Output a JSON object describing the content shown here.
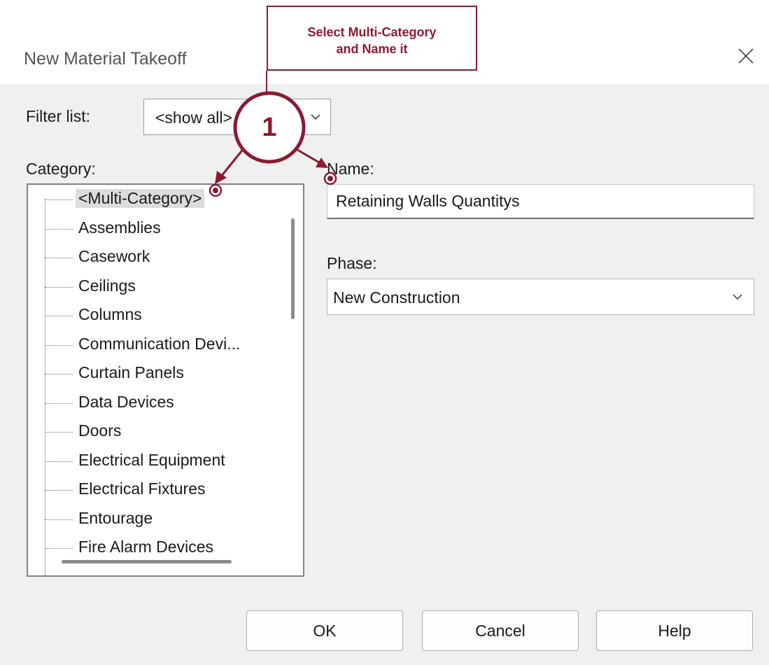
{
  "dialog": {
    "title": "New Material Takeoff",
    "filter_label": "Filter list:",
    "filter_value": "<show all>",
    "category_label": "Category:",
    "categories": [
      {
        "label": "<Multi-Category>",
        "selected": true
      },
      {
        "label": "Assemblies"
      },
      {
        "label": "Casework"
      },
      {
        "label": "Ceilings"
      },
      {
        "label": "Columns"
      },
      {
        "label": "Communication Devi..."
      },
      {
        "label": "Curtain Panels"
      },
      {
        "label": "Data Devices"
      },
      {
        "label": "Doors"
      },
      {
        "label": "Electrical Equipment"
      },
      {
        "label": "Electrical Fixtures"
      },
      {
        "label": "Entourage"
      },
      {
        "label": "Fire Alarm Devices"
      }
    ],
    "name_label": "Name:",
    "name_value": "Retaining Walls Quantitys",
    "phase_label": "Phase:",
    "phase_value": "New Construction",
    "buttons": {
      "ok": "OK",
      "cancel": "Cancel",
      "help": "Help"
    }
  },
  "annotation": {
    "step": "1",
    "callout_line1": "Select Multi-Category",
    "callout_line2": "and Name it",
    "color": "#8b1a33"
  },
  "icons": [
    "close-icon",
    "chevron-down-icon"
  ]
}
